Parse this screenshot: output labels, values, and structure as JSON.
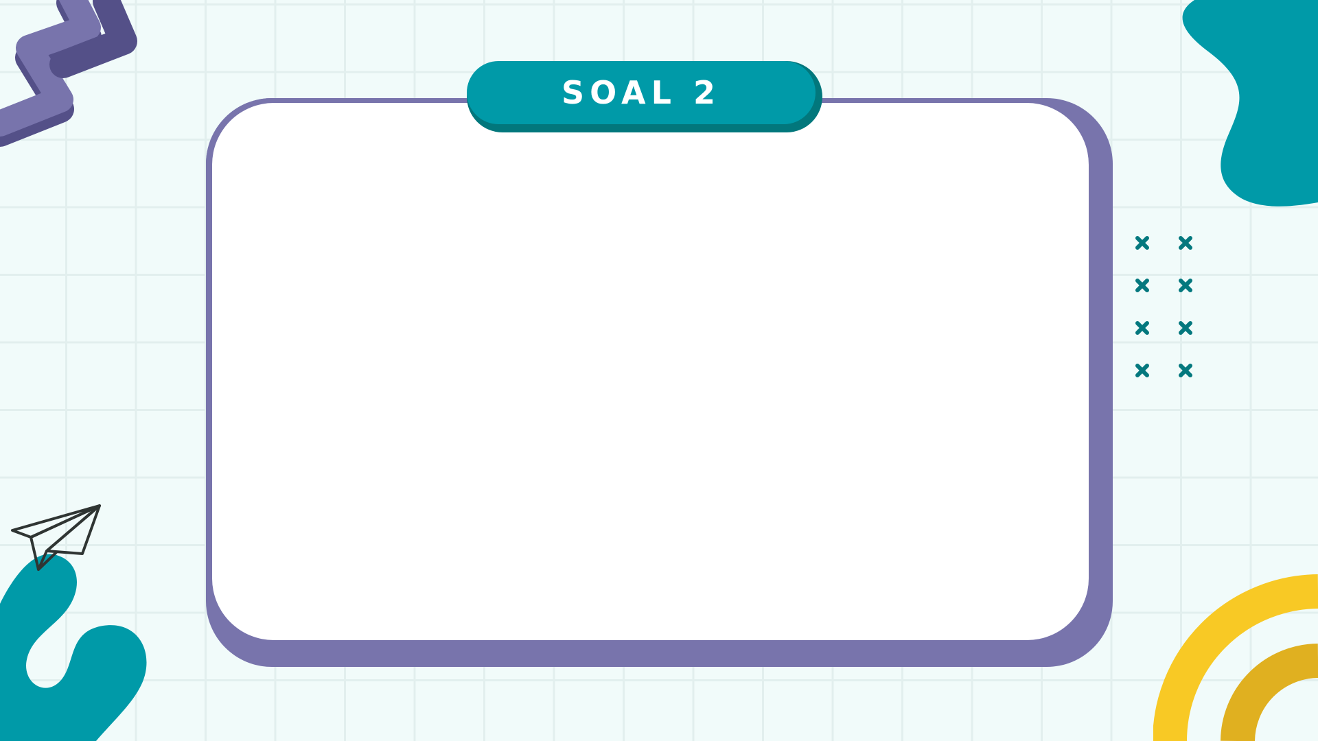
{
  "slide": {
    "title": "SOAL 2"
  },
  "colors": {
    "background": "#f1fbfa",
    "grid": "#e2efee",
    "card_border": "#7874ac",
    "card_fill": "#ffffff",
    "title_pill": "#009aa8",
    "title_pill_shadow": "#02777c",
    "teal_accent": "#009aa8",
    "x_marks": "#04787e",
    "purple_zigzag": "#7874ac",
    "purple_zigzag_shadow": "#545088",
    "yellow_arc": "#f8c925",
    "mustard_arc": "#e0b020",
    "plane_stroke": "#2f3533"
  },
  "icons": [
    "paper-plane-icon",
    "x-mark-icon",
    "zigzag-shape",
    "teal-blob-shape",
    "rainbow-arc-shape"
  ]
}
